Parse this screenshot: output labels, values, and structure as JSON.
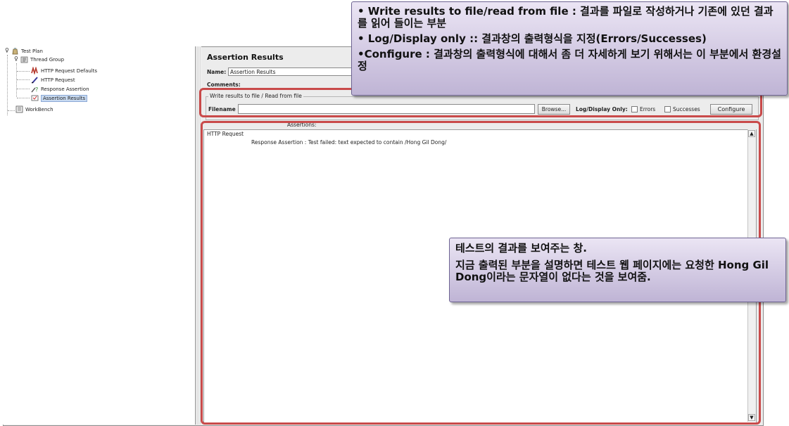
{
  "tree": {
    "items": [
      {
        "label": "Test Plan",
        "icon": "test-plan-icon"
      },
      {
        "label": "Thread Group",
        "icon": "thread-group-icon"
      },
      {
        "label": "HTTP Request Defaults",
        "icon": "config-icon"
      },
      {
        "label": "HTTP Request",
        "icon": "sampler-pen-icon"
      },
      {
        "label": "Response Assertion",
        "icon": "assertion-icon"
      },
      {
        "label": "Assertion Results",
        "icon": "listener-icon"
      },
      {
        "label": "WorkBench",
        "icon": "workbench-icon"
      }
    ]
  },
  "panel": {
    "title": "Assertion Results",
    "name_label": "Name:",
    "name_value": "Assertion Results",
    "comments_label": "Comments:",
    "file_group_label": "Write results to file / Read from file",
    "filename_label": "Filename",
    "filename_value": "",
    "browse_label": "Browse...",
    "log_display_label": "Log/Display Only:",
    "errors_label": "Errors",
    "successes_label": "Successes",
    "configure_label": "Configure",
    "assertions_label": "Assertions:"
  },
  "results": {
    "lines": [
      "HTTP Request",
      "Response Assertion : Test failed: text expected to contain /Hong Gil Dong/"
    ]
  },
  "callout_top": {
    "line1": "• Write results to file/read from file : 결과를 파일로 작성하거나 기존에 있던 결과를 읽어 들이는 부분",
    "line2": "• Log/Display only :: 결과창의 출력형식을 지정(Errors/Successes)",
    "line3": "•Configure : 결과창의 출력형식에 대해서 좀 더 자세하게 보기 위해서는 이 부분에서 환경설정"
  },
  "callout_bottom": {
    "line1": "테스트의 결과를 보여주는 창.",
    "line2": "지금 출력된 부분을 설명하면 테스트 웹 페이지에는 요청한 Hong Gil Dong이라는 문자열이 없다는 것을 보여줌."
  },
  "colors": {
    "highlight_red": "#c94a4a",
    "callout_purple": "#bfb4d5",
    "selection_blue": "#c8daf1"
  }
}
